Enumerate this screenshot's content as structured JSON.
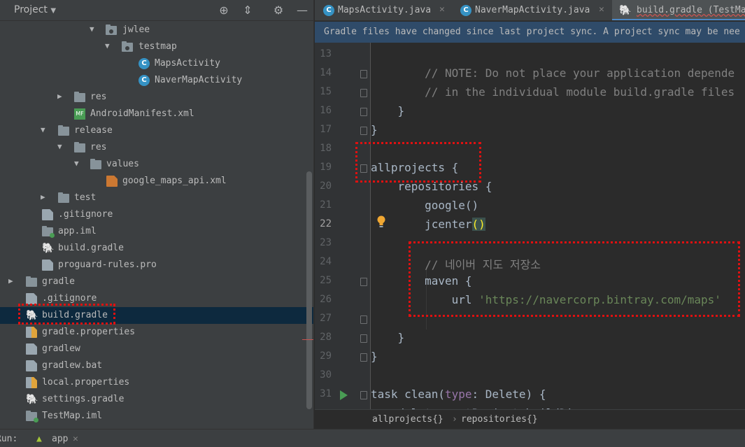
{
  "project_panel": {
    "title": "Project",
    "header_icons": [
      "locate-icon",
      "collapse-icon",
      "settings-icon",
      "minimize-icon"
    ],
    "tree": [
      {
        "label": "jwlee",
        "icon": "package-folder-icon",
        "expanded": true
      },
      {
        "label": "testmap",
        "icon": "package-folder-icon",
        "expanded": true
      },
      {
        "label": "MapsActivity",
        "icon": "class-icon",
        "icon_letter": "C"
      },
      {
        "label": "NaverMapActivity",
        "icon": "class-icon",
        "icon_letter": "C"
      },
      {
        "label": "res",
        "icon": "res-folder-icon",
        "expanded": false
      },
      {
        "label": "AndroidManifest.xml",
        "icon": "manifest-icon",
        "icon_text": "MF"
      },
      {
        "label": "release",
        "icon": "folder-icon",
        "expanded": true
      },
      {
        "label": "res",
        "icon": "folder-icon",
        "expanded": true
      },
      {
        "label": "values",
        "icon": "folder-icon",
        "expanded": true
      },
      {
        "label": "google_maps_api.xml",
        "icon": "xml-file-icon"
      },
      {
        "label": "test",
        "icon": "folder-icon",
        "expanded": false
      },
      {
        "label": ".gitignore",
        "icon": "ignored-file-icon"
      },
      {
        "label": "app.iml",
        "icon": "module-icon"
      },
      {
        "label": "build.gradle",
        "icon": "gradle-icon"
      },
      {
        "label": "proguard-rules.pro",
        "icon": "text-file-icon"
      },
      {
        "label": "gradle",
        "icon": "folder-icon",
        "expanded": false
      },
      {
        "label": ".gitignore",
        "icon": "ignored-file-icon"
      },
      {
        "label": "build.gradle",
        "icon": "gradle-icon",
        "selected": true
      },
      {
        "label": "gradle.properties",
        "icon": "properties-file-icon"
      },
      {
        "label": "gradlew",
        "icon": "script-file-icon"
      },
      {
        "label": "gradlew.bat",
        "icon": "text-file-icon"
      },
      {
        "label": "local.properties",
        "icon": "properties-file-icon"
      },
      {
        "label": "settings.gradle",
        "icon": "gradle-icon"
      },
      {
        "label": "TestMap.iml",
        "icon": "module-icon"
      }
    ]
  },
  "tabs": [
    {
      "label": "MapsActivity.java",
      "icon": "class-icon",
      "icon_letter": "C",
      "active": false
    },
    {
      "label": "NaverMapActivity.java",
      "icon": "class-icon",
      "icon_letter": "C",
      "active": false
    },
    {
      "label": "build.gradle (TestMa",
      "icon": "gradle-icon",
      "active": true
    }
  ],
  "notice": "Gradle files have changed since last project sync. A project sync may be nee",
  "editor": {
    "current_line": "22",
    "lines": [
      {
        "n": "13",
        "parts": []
      },
      {
        "n": "14",
        "parts": [
          {
            "t": "        // NOTE: Do not place your application depende",
            "c": "comment"
          }
        ]
      },
      {
        "n": "15",
        "parts": [
          {
            "t": "        // in the individual module build.gradle files",
            "c": "comment"
          }
        ]
      },
      {
        "n": "16",
        "parts": [
          {
            "t": "    }",
            "c": "plain"
          }
        ]
      },
      {
        "n": "17",
        "parts": [
          {
            "t": "}",
            "c": "plain"
          }
        ]
      },
      {
        "n": "18",
        "parts": []
      },
      {
        "n": "19",
        "parts": [
          {
            "t": "allprojects {",
            "c": "plain"
          }
        ]
      },
      {
        "n": "20",
        "parts": [
          {
            "t": "    repositories {",
            "c": "plain"
          }
        ]
      },
      {
        "n": "21",
        "parts": [
          {
            "t": "        google()",
            "c": "plain"
          }
        ]
      },
      {
        "n": "22",
        "parts": [
          {
            "t": "        jcenter",
            "c": "plain"
          },
          {
            "t": "()",
            "c": "paren-hl"
          }
        ]
      },
      {
        "n": "23",
        "parts": []
      },
      {
        "n": "24",
        "parts": [
          {
            "t": "        // 네이버 지도 저장소",
            "c": "comment"
          }
        ]
      },
      {
        "n": "25",
        "parts": [
          {
            "t": "        maven {",
            "c": "plain"
          }
        ]
      },
      {
        "n": "26",
        "parts": [
          {
            "t": "            url ",
            "c": "plain"
          },
          {
            "t": "'https://navercorp.bintray.com/maps'",
            "c": "str"
          }
        ]
      },
      {
        "n": "27",
        "parts": []
      },
      {
        "n": "28",
        "parts": [
          {
            "t": "    }",
            "c": "plain"
          }
        ]
      },
      {
        "n": "29",
        "parts": [
          {
            "t": "}",
            "c": "plain"
          }
        ]
      },
      {
        "n": "30",
        "parts": []
      },
      {
        "n": "31",
        "parts": [
          {
            "t": "task clean(",
            "c": "plain"
          },
          {
            "t": "type",
            "c": "param"
          },
          {
            "t": ": Delete) {",
            "c": "plain"
          }
        ]
      },
      {
        "n": "",
        "parts": [
          {
            "t": "    delete rootProject.buildDir",
            "c": "plain"
          }
        ]
      }
    ]
  },
  "breadcrumb": [
    "allprojects{}",
    "repositories{}"
  ],
  "runbar": {
    "label": "Run:",
    "config": "app"
  },
  "colors": {
    "accent": "#4a88c7",
    "selection": "#0d293e",
    "annotation": "#e01010"
  }
}
